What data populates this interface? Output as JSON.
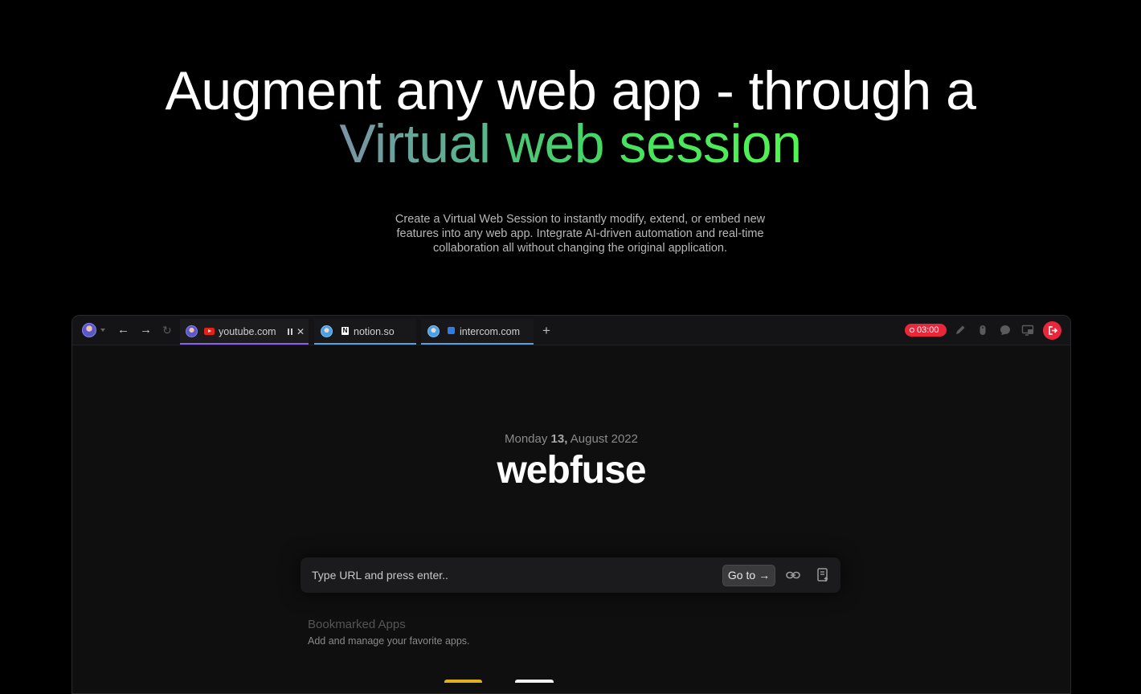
{
  "hero": {
    "title_line1": "Augment any web app - through a",
    "title_word1": "Virtual",
    "title_word2": "web",
    "title_word3": "session",
    "subtitle_line1": "Create a Virtual Web Session to instantly modify, extend, or embed new",
    "subtitle_line2": "features into any web app. Integrate AI-driven automation and real-time",
    "subtitle_line3": "collaboration all without changing the original application."
  },
  "browser": {
    "tabs": [
      {
        "label": "youtube.com",
        "icon": "youtube-icon",
        "active": true
      },
      {
        "label": "notion.so",
        "icon": "notion-icon"
      },
      {
        "label": "intercom.com",
        "icon": "intercom-icon"
      }
    ],
    "new_tab_label": "+",
    "recording": {
      "time": "03:00",
      "color": "#e8283a"
    },
    "tools": [
      "pencil-icon",
      "mouse-icon",
      "chat-icon",
      "screen-share-icon",
      "exit-icon"
    ]
  },
  "page": {
    "date_weekday": "Monday",
    "date_day": "13,",
    "date_month_year": "August 2022",
    "logo": "webfuse",
    "url_placeholder": "Type URL and press enter..",
    "goto_label": "Go to",
    "goto_arrow": "→",
    "bookmarks_title": "Bookmarked Apps",
    "bookmarks_subtitle": "Add and manage your favorite apps."
  },
  "colors": {
    "accent_purple": "#8a5cf0",
    "accent_blue": "#5aa0e0",
    "record_red": "#e8283a",
    "gradient_green": "#4cf05a"
  }
}
